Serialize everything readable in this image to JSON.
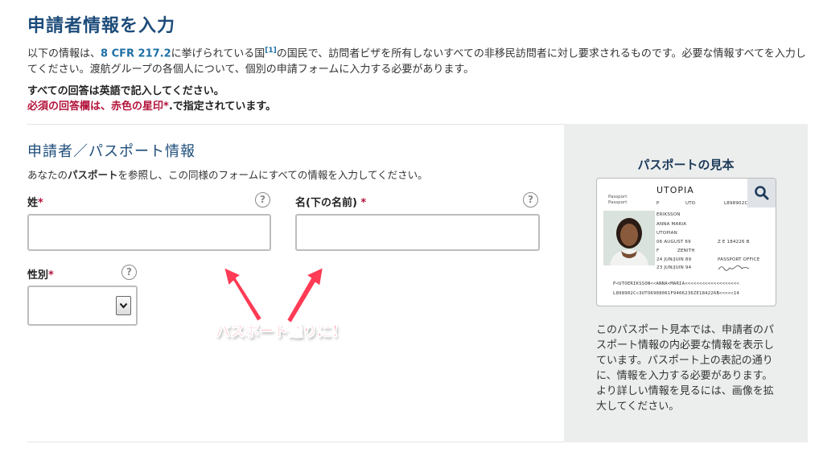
{
  "header": {
    "title": "申請者情報を入力",
    "intro_part1": "以下の情報は、",
    "intro_cfr": "8 CFR 217.2",
    "intro_part2": "に挙げられている国",
    "intro_footnote": "[1]",
    "intro_part3": "の国民で、訪問者ビザを所有しないすべての非移民訪問者に対し要求されるものです。必要な情報すべてを入力してください。渡航グループの各個人について、個別の申請フォームに入力する必要があります。",
    "english_notice": "すべての回答は英語で記入してください。",
    "required_notice_red": "必須の回答欄は、赤色の星印",
    "required_notice_star": "*",
    "required_notice_rest": ".で指定されています。"
  },
  "form": {
    "section_title": "申請者／パスポート情報",
    "desc_part1": "あなたの",
    "desc_bold": "パスポート",
    "desc_part2": "を参照し、この同様のフォームにすべての情報を入力してください。",
    "required_mark": "*",
    "help_glyph": "?",
    "last_name": {
      "label": "姓",
      "value": ""
    },
    "first_name": {
      "label": "名(下の名前)",
      "value": ""
    },
    "gender": {
      "label": "性別",
      "selected": ""
    },
    "select_arrow": "⌄"
  },
  "annotation": {
    "callout": "パスポート通りに！",
    "color": "#ff3b55"
  },
  "sample_panel": {
    "title": "パスポートの見本",
    "zoom_icon": "search-icon",
    "passport": {
      "country": "UTOPIA",
      "type_label_1": "Passport",
      "type_label_2": "Passport",
      "type_code": "P",
      "state_code": "UTO",
      "passport_no": "L898902C",
      "surname": "ERIKSSON",
      "given_names": "ANNA MARIA",
      "nationality": "UTOPIAN",
      "dob": "06 AUGUST 69",
      "personal_no": "Z E 184226 B",
      "sex": "F",
      "birth_place": "ZENITH",
      "issue_date": "24 JUN/JUIN 89",
      "authority": "PASSPORT OFFICE",
      "expiry_date": "23 JUN/JUIN 94",
      "mrz_line_1": "P<UTOERIKSSON<<ANNA<MARIA<<<<<<<<<<<<<<<<<<<",
      "mrz_line_2": "L898902C<3UTO6908061F9406236ZE184226B<<<<<14"
    },
    "description": "このパスポート見本では、申請者のパスポート情報の内必要な情報を表示しています。パスポート上の表記の通りに、情報を入力する必要があります。より詳しい情報を見るには、画像を拡大してください。"
  },
  "colors": {
    "title_blue": "#1d4c7a",
    "required_red": "#b3133b",
    "panel_bg": "#eceeed"
  }
}
